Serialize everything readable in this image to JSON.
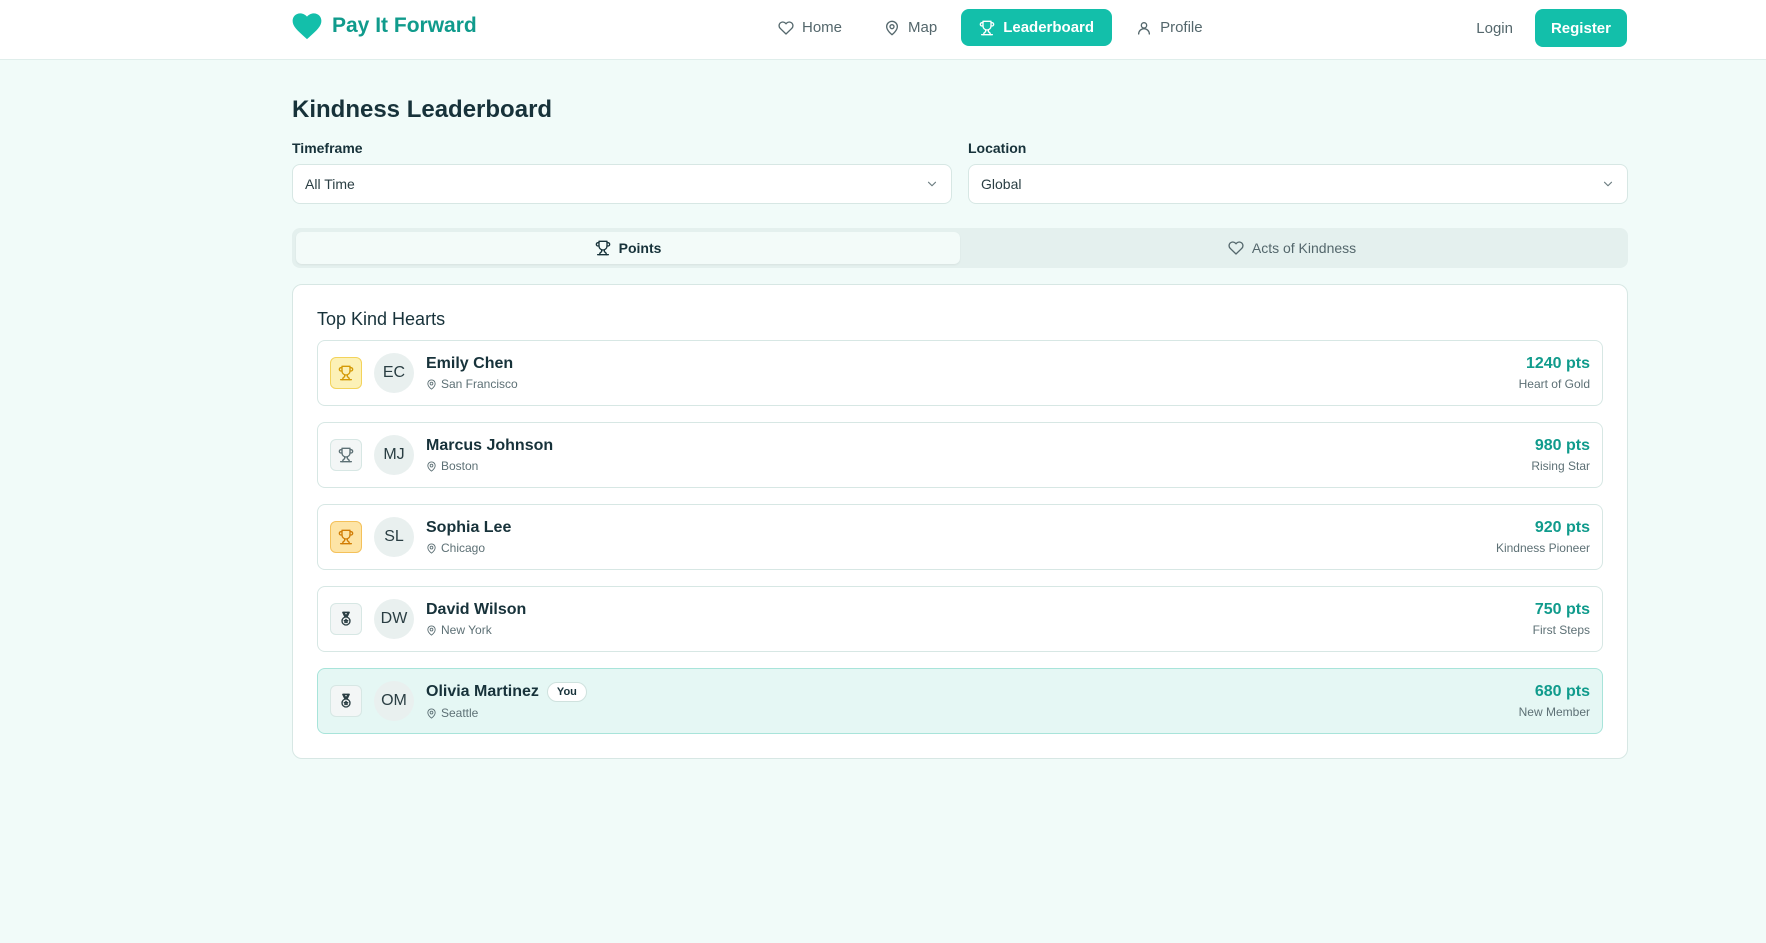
{
  "brand": {
    "name": "Pay It Forward",
    "color": "#13bfaa"
  },
  "nav": {
    "links": [
      {
        "label": "Home",
        "icon": "heart-icon"
      },
      {
        "label": "Map",
        "icon": "map-pin-icon"
      },
      {
        "label": "Leaderboard",
        "icon": "trophy-icon",
        "active": true
      },
      {
        "label": "Profile",
        "icon": "user-icon"
      }
    ],
    "login": "Login",
    "register": "Register"
  },
  "page": {
    "title": "Kindness Leaderboard"
  },
  "filters": {
    "timeframe": {
      "label": "Timeframe",
      "value": "All Time"
    },
    "location": {
      "label": "Location",
      "value": "Global"
    }
  },
  "tabs": [
    {
      "label": "Points",
      "icon": "trophy-icon",
      "active": true
    },
    {
      "label": "Acts of Kindness",
      "icon": "heart-icon",
      "active": false
    }
  ],
  "leaderboard": {
    "title": "Top Kind Hearts",
    "you_label": "You",
    "rows": [
      {
        "initials": "EC",
        "name": "Emily Chen",
        "location": "San Francisco",
        "points": "1240 pts",
        "badge": "Heart of Gold",
        "rank_icon": "trophy-icon",
        "rank_style": "gold"
      },
      {
        "initials": "MJ",
        "name": "Marcus Johnson",
        "location": "Boston",
        "points": "980 pts",
        "badge": "Rising Star",
        "rank_icon": "trophy-icon",
        "rank_style": "silver"
      },
      {
        "initials": "SL",
        "name": "Sophia Lee",
        "location": "Chicago",
        "points": "920 pts",
        "badge": "Kindness Pioneer",
        "rank_icon": "trophy-icon",
        "rank_style": "amber"
      },
      {
        "initials": "DW",
        "name": "David Wilson",
        "location": "New York",
        "points": "750 pts",
        "badge": "First Steps",
        "rank_icon": "medal-icon",
        "rank_style": "plain"
      },
      {
        "initials": "OM",
        "name": "Olivia Martinez",
        "location": "Seattle",
        "points": "680 pts",
        "badge": "New Member",
        "rank_icon": "medal-icon",
        "rank_style": "plain",
        "is_you": true
      }
    ]
  }
}
